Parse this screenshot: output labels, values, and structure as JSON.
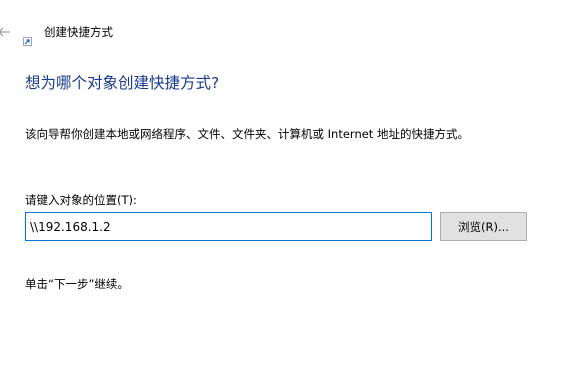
{
  "window": {
    "title": "创建快捷方式",
    "back_icon": "back-arrow-icon",
    "title_icon": "shortcut-icon"
  },
  "page": {
    "heading": "想为哪个对象创建快捷方式?",
    "description": "该向导帮你创建本地或网络程序、文件、文件夹、计算机或 Internet 地址的快捷方式。",
    "location_label": "请键入对象的位置(T):",
    "location_value": "\\\\192.168.1.2",
    "browse_label": "浏览(R)...",
    "hint": "单击“下一步”继续。"
  },
  "colors": {
    "heading": "#1a3b8f",
    "input_border": "#0078d7",
    "button_bg": "#e1e1e1"
  }
}
